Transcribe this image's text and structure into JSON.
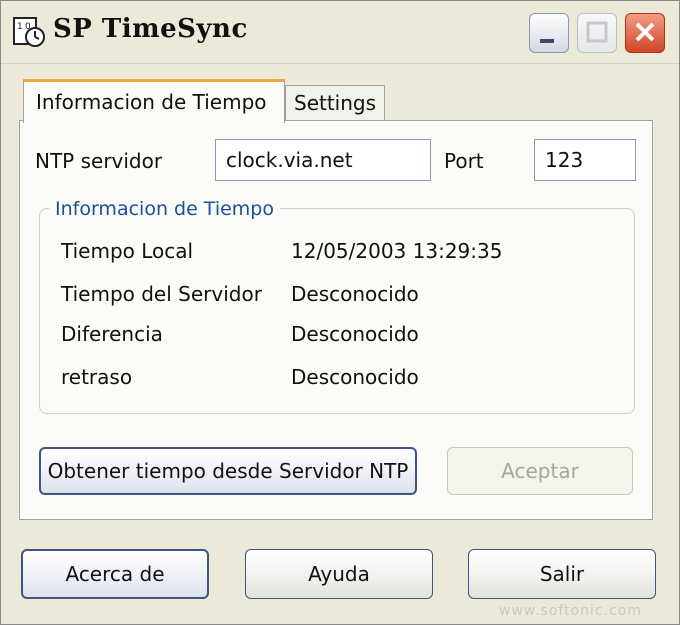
{
  "window": {
    "title": "SP TimeSync",
    "controls": [
      "minimize-icon",
      "maximize-icon",
      "close-icon"
    ]
  },
  "tabs": [
    {
      "label": "Informacion de Tiempo",
      "active": true
    },
    {
      "label": "Settings",
      "active": false
    }
  ],
  "ntp": {
    "server_label": "NTP servidor",
    "server_value": "clock.via.net",
    "port_label": "Port",
    "port_value": "123"
  },
  "info_group": {
    "title": "Informacion de Tiempo",
    "rows": [
      {
        "label": "Tiempo Local",
        "value": "12/05/2003 13:29:35"
      },
      {
        "label": "Tiempo del Servidor",
        "value": "Desconocido"
      },
      {
        "label": "Diferencia",
        "value": "Desconocido"
      },
      {
        "label": "retraso",
        "value": "Desconocido"
      }
    ]
  },
  "actions": {
    "fetch_label": "Obtener tiempo desde Servidor NTP",
    "accept_label": "Aceptar"
  },
  "footer": {
    "about_label": "Acerca de",
    "help_label": "Ayuda",
    "exit_label": "Salir"
  },
  "watermark": "www.softonic.com",
  "colors": {
    "window_bg": "#ece9d8",
    "group_title": "#1c4f98",
    "active_tab_accent": "#f2a93b",
    "close_button": "#d3452a"
  }
}
